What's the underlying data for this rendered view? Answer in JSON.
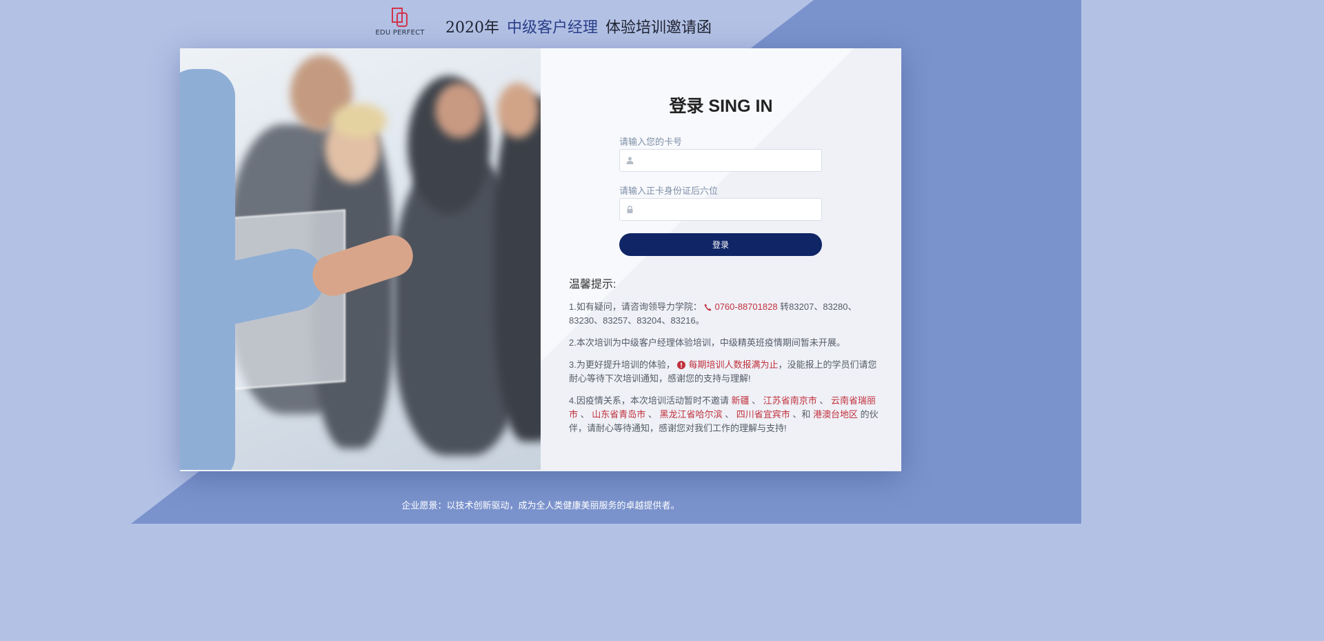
{
  "header": {
    "logo_text": "EDU PERFECT",
    "title_prefix": "2020年",
    "title_accent": "中级客户经理",
    "title_suffix": "体验培训邀请函"
  },
  "login": {
    "title": "登录 SING IN",
    "card_label": "请输入您的卡号",
    "id_label": "请输入正卡身份证后六位",
    "button_label": "登录"
  },
  "tips": {
    "title": "温馨提示:",
    "tip1_a": "1.如有疑问，请咨询领导力学院：",
    "tip1_phone": "0760-88701828",
    "tip1_b": " 转83207、83280、83230、83257、83204、83216。",
    "tip2": "2.本次培训为中级客户经理体验培训，中级精英班疫情期间暂未开展。",
    "tip3_a": "3.为更好提升培训的体验，",
    "tip3_warn": "每期培训人数报满为止",
    "tip3_b": "，没能报上的学员们请您耐心等待下次培训通知，感谢您的支持与理解!",
    "tip4_a": "4.因疫情关系，本次培训活动暂时不邀请 ",
    "regions": [
      "新疆",
      "江苏省南京市",
      "云南省瑞丽市",
      "山东省青岛市",
      "黑龙江省哈尔滨",
      "四川省宜宾市",
      "港澳台地区"
    ],
    "sep": " 、 ",
    "and": " 、和",
    "tip4_b": " 的伙伴，请耐心等待通知，感谢您对我们工作的理解与支持!"
  },
  "footer": {
    "text": "企业愿景：以技术创新驱动，成为全人类健康美丽服务的卓越提供者。"
  },
  "colors": {
    "accent_navy": "#0f2566",
    "highlight_red": "#c1303c",
    "bg_light": "#b3c1e5",
    "bg_dark": "#7b93cd"
  }
}
